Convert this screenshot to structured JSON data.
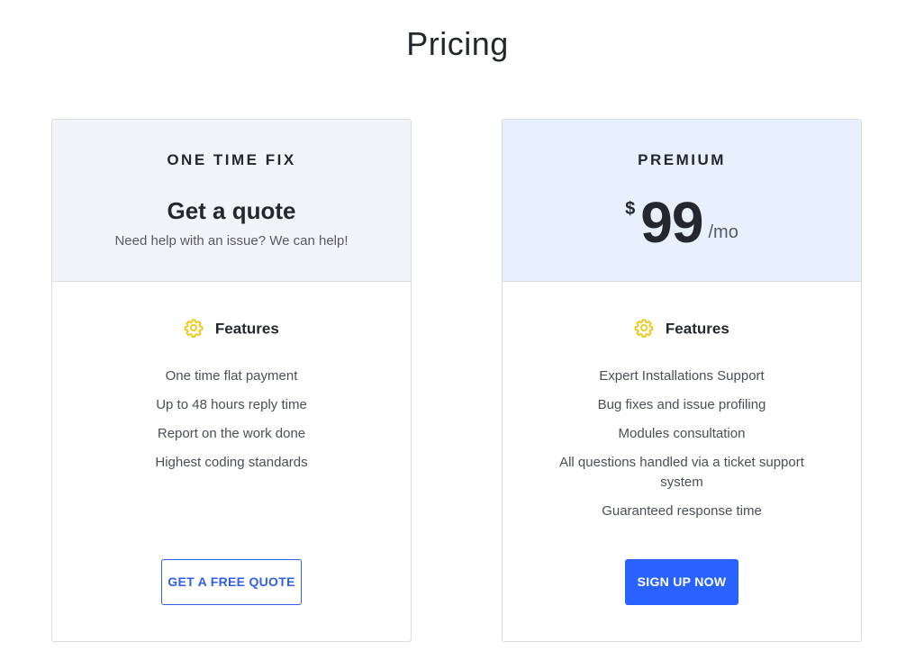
{
  "page": {
    "title": "Pricing"
  },
  "colors": {
    "accent": "#2962ff",
    "gear_icon": "#f2c200",
    "left_header_bg": "#f3f4f7",
    "right_header_bg": "#e8f0fd"
  },
  "plans": [
    {
      "name": "ONE TIME FIX",
      "headline": "Get a quote",
      "subtitle": "Need help with an issue? We can help!",
      "features_heading": "Features",
      "features_icon": "gear-icon",
      "features": [
        "One time flat payment",
        "Up to 48 hours reply time",
        "Report on the work done",
        "Highest coding standards"
      ],
      "button_label": "GET A FREE QUOTE"
    },
    {
      "name": "PREMIUM",
      "price": {
        "currency": "$",
        "amount": "99",
        "period": "/mo"
      },
      "features_heading": "Features",
      "features_icon": "gear-icon",
      "features": [
        "Expert Installations Support",
        "Bug fixes and issue profiling",
        "Modules consultation",
        "All questions handled via a ticket support system",
        "Guaranteed response time"
      ],
      "button_label": "SIGN UP NOW"
    }
  ]
}
